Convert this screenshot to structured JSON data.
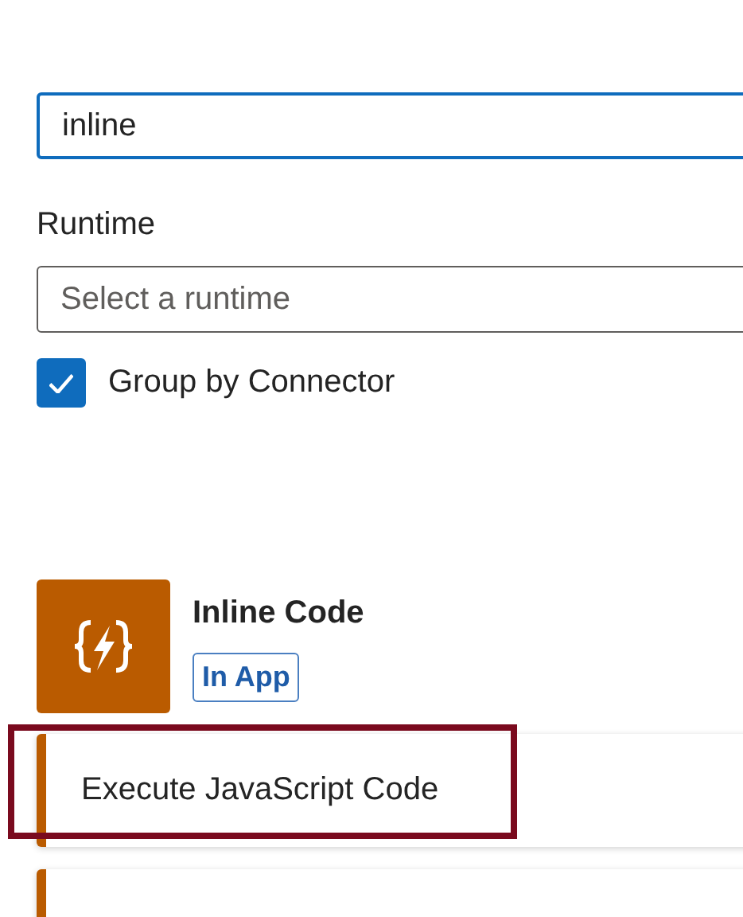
{
  "search": {
    "value": "inline",
    "focused": true
  },
  "runtime": {
    "label": "Runtime",
    "placeholder": "Select a runtime"
  },
  "group_by_connector": {
    "label": "Group by Connector",
    "checked": true
  },
  "connector": {
    "name": "Inline Code",
    "badge": "In App",
    "color": "#ba5b00"
  },
  "actions": [
    {
      "name": "Execute JavaScript Code",
      "highlighted": true
    },
    {
      "highlighted": false
    }
  ]
}
